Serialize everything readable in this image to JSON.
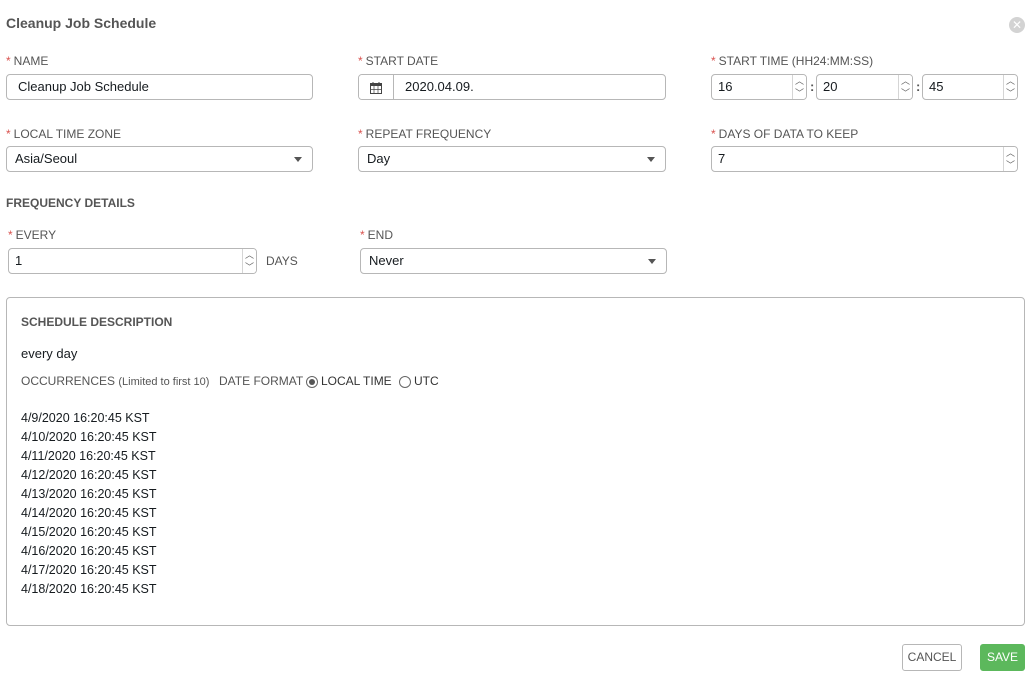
{
  "modal": {
    "title": "Cleanup Job Schedule",
    "close_glyph": "✕"
  },
  "required_marker": "*",
  "form": {
    "name": {
      "label": "NAME",
      "value": "Cleanup Job Schedule"
    },
    "start_date": {
      "label": "START DATE",
      "value": "2020.04.09.",
      "icon": "calendar-icon"
    },
    "start_time": {
      "label": "START TIME (HH24:MM:SS)",
      "hours": "16",
      "minutes": "20",
      "seconds": "45",
      "separator": ":"
    },
    "time_zone": {
      "label": "LOCAL TIME ZONE",
      "value": "Asia/Seoul"
    },
    "repeat_frequency": {
      "label": "REPEAT FREQUENCY",
      "value": "Day"
    },
    "days_to_keep": {
      "label": "DAYS OF DATA TO KEEP",
      "value": "7"
    }
  },
  "frequency_details": {
    "heading": "FREQUENCY DETAILS",
    "every": {
      "label": "EVERY",
      "value": "1",
      "unit": "DAYS"
    },
    "end": {
      "label": "END",
      "value": "Never"
    }
  },
  "schedule_description": {
    "heading": "SCHEDULE DESCRIPTION",
    "summary": "every day",
    "occurrences_label": "OCCURRENCES",
    "occurrences_note": "(Limited to first 10)",
    "date_format_label": "DATE FORMAT",
    "format_options": [
      {
        "label": "LOCAL TIME",
        "selected": true
      },
      {
        "label": "UTC",
        "selected": false
      }
    ],
    "occurrences": [
      "4/9/2020 16:20:45 KST",
      "4/10/2020 16:20:45 KST",
      "4/11/2020 16:20:45 KST",
      "4/12/2020 16:20:45 KST",
      "4/13/2020 16:20:45 KST",
      "4/14/2020 16:20:45 KST",
      "4/15/2020 16:20:45 KST",
      "4/16/2020 16:20:45 KST",
      "4/17/2020 16:20:45 KST",
      "4/18/2020 16:20:45 KST"
    ]
  },
  "actions": {
    "cancel_label": "CANCEL",
    "save_label": "SAVE"
  },
  "colors": {
    "required": "#d9534f",
    "save_button": "#5cb85c",
    "border": "#b7b7b7"
  }
}
